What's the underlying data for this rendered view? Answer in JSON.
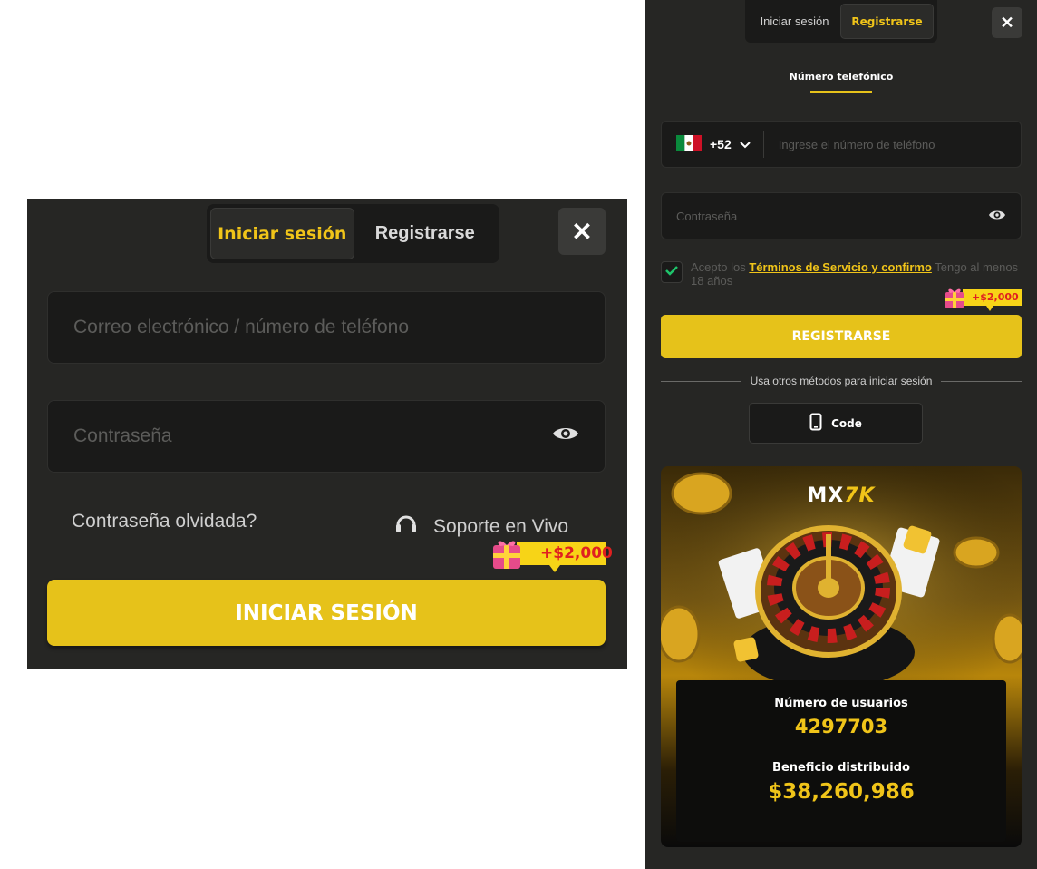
{
  "login": {
    "tabs": [
      "Iniciar sesión",
      "Registrarse"
    ],
    "active_tab": "Iniciar sesión",
    "close_icon": "close-icon",
    "email_placeholder": "Correo electrónico / número de teléfono",
    "password_placeholder": "Contraseña",
    "forgot_label": "Contraseña olvidada?",
    "support_label": "Soporte en Vivo",
    "bonus_badge": "+$2,000",
    "submit_label": "INICIAR SESIÓN"
  },
  "register": {
    "tabs": [
      "Iniciar sesión",
      "Registrarse"
    ],
    "active_tab": "Registrarse",
    "close_icon": "close-icon",
    "method_tab": "Número telefónico",
    "country_code": "+52",
    "country_flag": "mexico-flag-icon",
    "phone_placeholder": "Ingrese el número de teléfono",
    "password_placeholder": "Contraseña",
    "terms_checked": true,
    "terms_prefix": "Acepto los ",
    "terms_link": "Términos de Servicio y confirmo",
    "terms_suffix": " Tengo al menos 18 años",
    "bonus_badge": "+$2,000",
    "submit_label": "REGISTRARSE",
    "divider_text": "Usa otros métodos para iniciar sesión",
    "code_button_label": "Code",
    "promo": {
      "brand_main": "MX",
      "brand_accent": "7K",
      "users_label": "Número de usuarios",
      "users_value": "4297703",
      "benefit_label": "Beneficio distribuido",
      "benefit_value": "$38,260,986"
    }
  },
  "colors": {
    "accent": "#e6c21a",
    "panel_bg": "#262624",
    "field_bg": "#1a1a19"
  }
}
